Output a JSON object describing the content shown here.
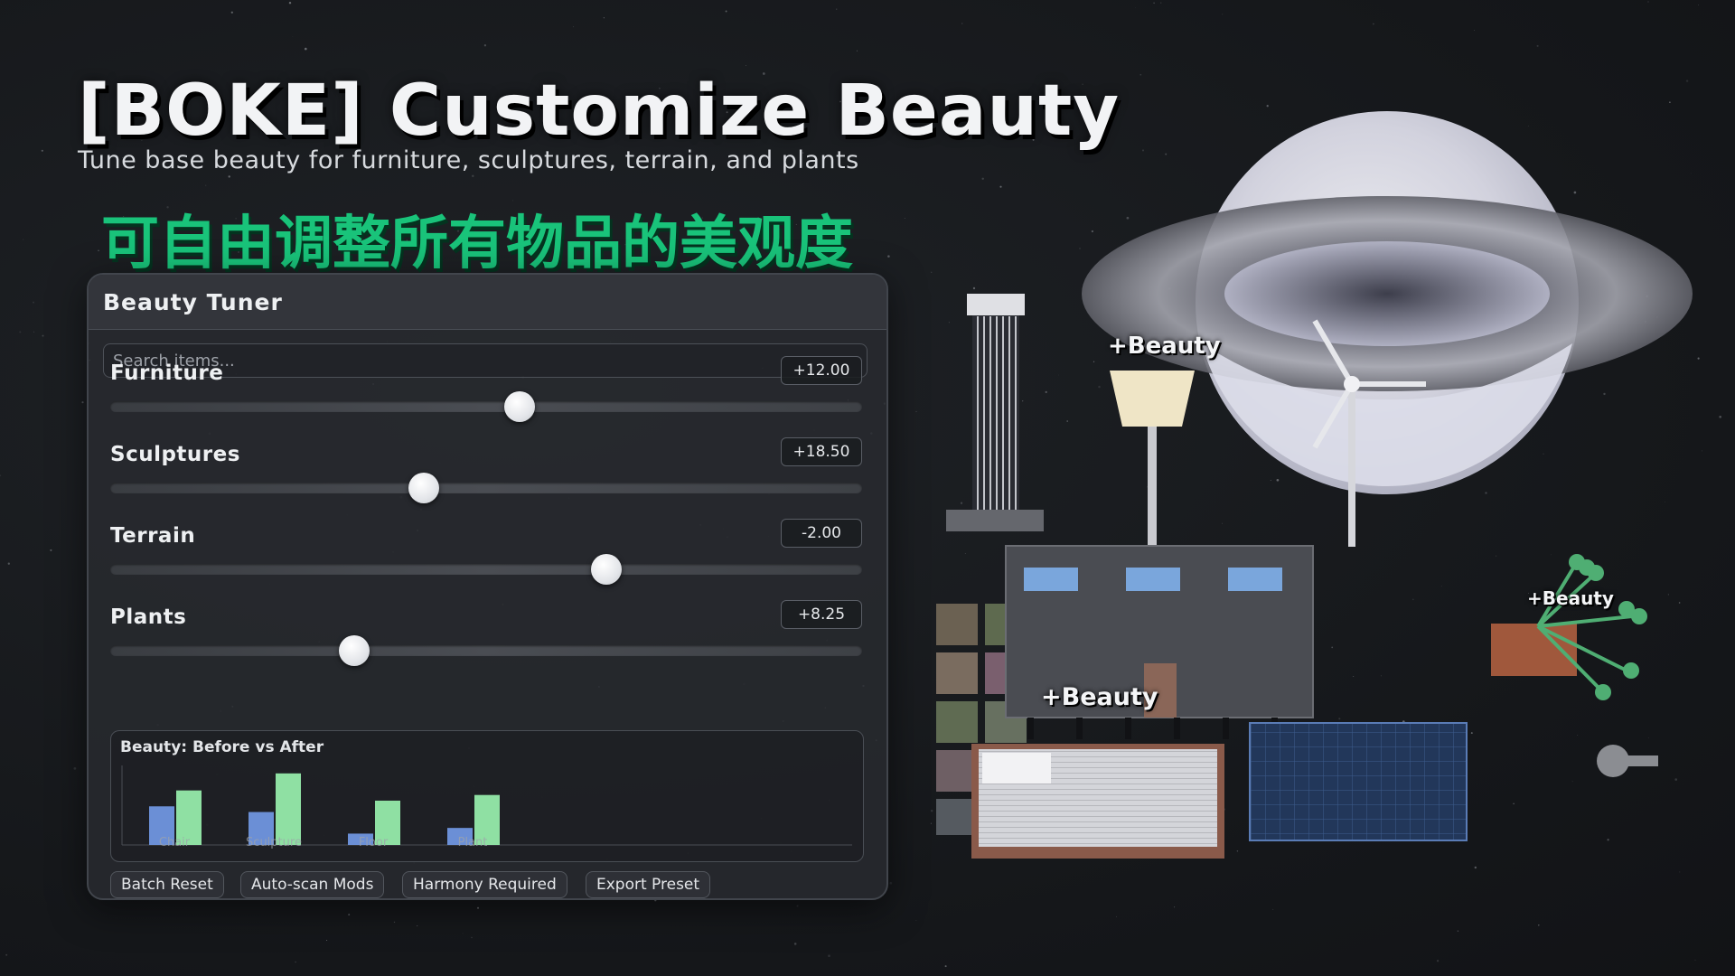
{
  "title": "[BOKE] Customize Beauty",
  "subtitle": "Tune base beauty for furniture, sculptures, terrain, and plants",
  "cn_title": "可自由调整所有物品的美观度",
  "panel": {
    "title": "Beauty Tuner",
    "search_placeholder": "Search items...",
    "sliders": [
      {
        "label": "Furniture",
        "value_text": "+12.00",
        "position": 0.545
      },
      {
        "label": "Sculptures",
        "value_text": "+18.50",
        "position": 0.417
      },
      {
        "label": "Terrain",
        "value_text": "-2.00",
        "position": 0.66
      },
      {
        "label": "Plants",
        "value_text": "+8.25",
        "position": 0.325
      }
    ],
    "buttons": [
      "Batch Reset",
      "Auto-scan Mods",
      "Harmony Required",
      "Export Preset"
    ]
  },
  "chart_data": {
    "type": "bar",
    "title": "Beauty: Before vs After",
    "categories": [
      "Chair",
      "Sculpture",
      "Floor",
      "Plant"
    ],
    "series": [
      {
        "values": [
          34,
          29,
          10,
          15
        ]
      },
      {
        "values": [
          48,
          63,
          39,
          44
        ]
      }
    ],
    "ylim": [
      0,
      70
    ],
    "colors": [
      "#6b8fd6",
      "#8fe0a3"
    ]
  },
  "scene": {
    "labels": [
      "+Beauty",
      "+Beauty",
      "+Beauty"
    ]
  },
  "colors": {
    "accent_green": "#19c37a",
    "panel_bg": "#2a2c31",
    "knob": "#e3e5e9"
  }
}
